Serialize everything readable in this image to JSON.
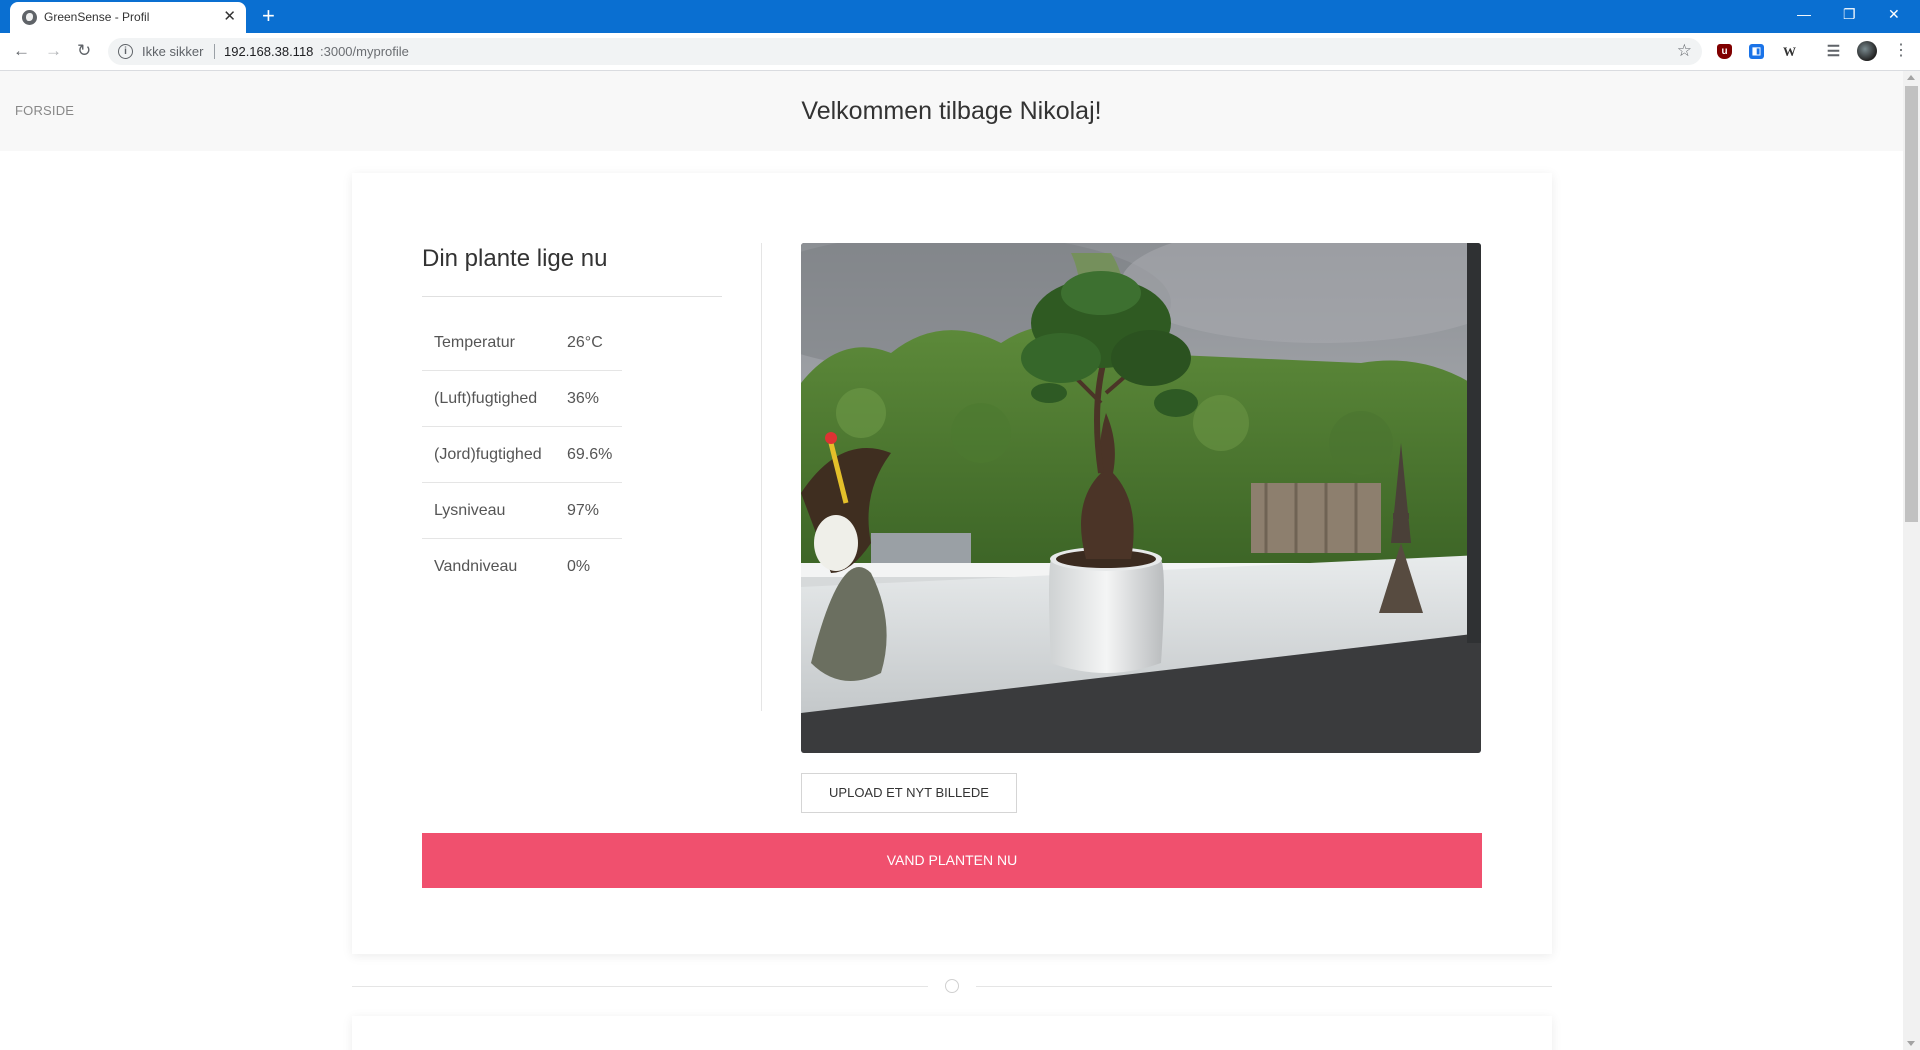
{
  "browser": {
    "tab_title": "GreenSense - Profil",
    "security_label": "Ikke sikker",
    "url_host": "192.168.38.118",
    "url_path": ":3000/myprofile"
  },
  "site": {
    "nav_home": "FORSIDE",
    "welcome": "Velkommen tilbage Nikolaj!"
  },
  "plant": {
    "section_title": "Din plante lige nu",
    "stats": [
      {
        "name": "Temperatur",
        "value": "26°C"
      },
      {
        "name": "(Luft)fugtighed",
        "value": "36%"
      },
      {
        "name": "(Jord)fugtighed",
        "value": "69.6%"
      },
      {
        "name": "Lysniveau",
        "value": "97%"
      },
      {
        "name": "Vandniveau",
        "value": "0%"
      }
    ],
    "upload_label": "UPLOAD ET NYT BILLEDE",
    "water_label": "VAND PLANTEN NU"
  },
  "colors": {
    "chrome_blue": "#0a6fd1",
    "accent_pink": "#f0506e"
  }
}
